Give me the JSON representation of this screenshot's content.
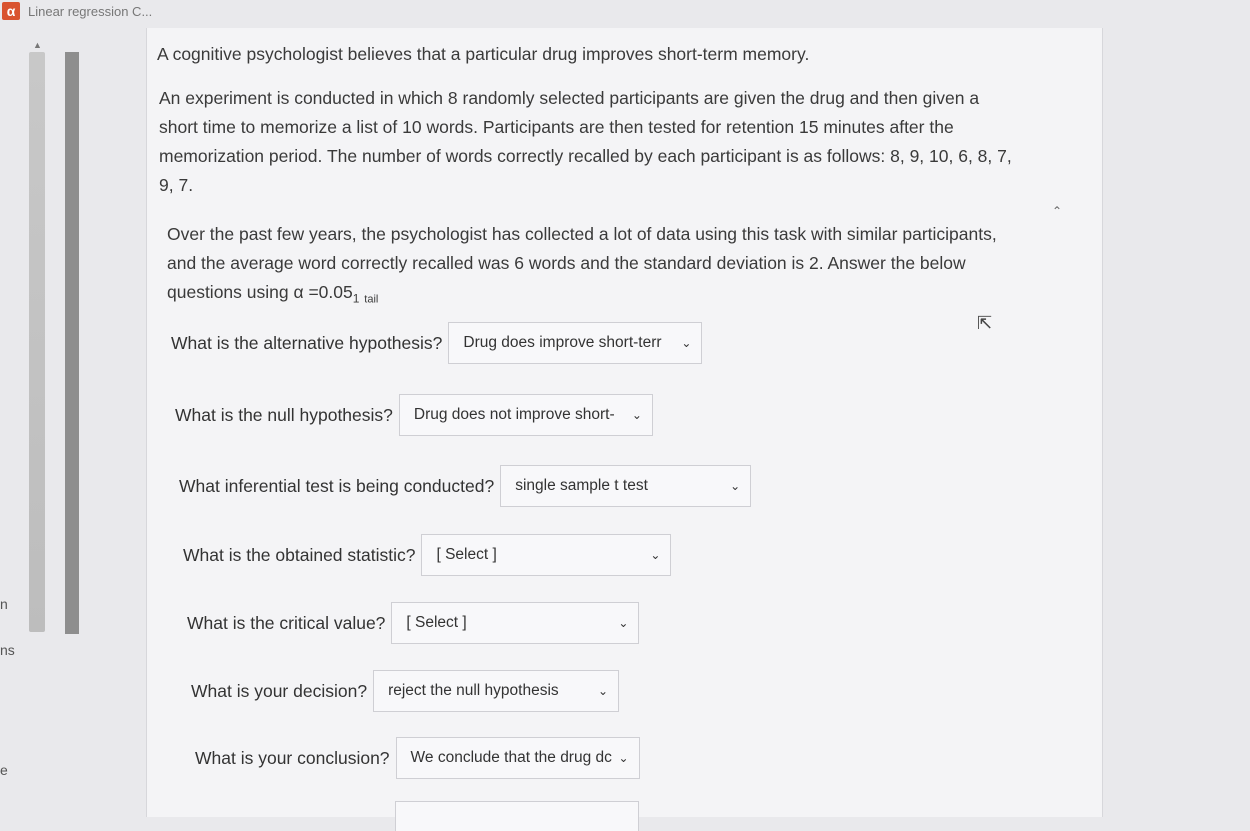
{
  "tab": {
    "icon": "α",
    "title": "Linear regression C..."
  },
  "edge_texts": [
    "n",
    "ns",
    "e"
  ],
  "intro": "A cognitive psychologist believes that a particular drug improves short-term memory.",
  "experiment": [
    "An experiment is conducted in which 8 randomly selected participants are given the drug and then given a",
    "short time to memorize a list of 10 words. Participants are then tested for retention 15 minutes after the",
    "memorization period. The number of words correctly recalled by each participant is as follows: 8, 9, 10, 6, 8, 7,",
    "9, 7."
  ],
  "background": {
    "line1": "Over the past few years, the psychologist has collected a lot of data using this task with similar participants,",
    "line2": "and the average word correctly recalled was 6 words and the standard deviation is 2. Answer the below",
    "line3_prefix": "questions using α =0.05",
    "line3_sub": "1",
    "line3_suffix": "tail"
  },
  "questions": [
    {
      "label": "What is the alternative hypothesis?",
      "value": "Drug does improve short-terr"
    },
    {
      "label": "What is the null hypothesis?",
      "value": "Drug does not improve short-"
    },
    {
      "label": "What inferential test is being conducted?",
      "value": "single sample t test"
    },
    {
      "label": "What is the obtained statistic?",
      "value": "[ Select ]"
    },
    {
      "label": "What is the critical value?",
      "value": "[ Select ]"
    },
    {
      "label": "What is your decision?",
      "value": "reject the null hypothesis"
    },
    {
      "label": "What is your conclusion?",
      "value": "We conclude that the drug dc"
    }
  ],
  "icons": {
    "chevron": "chevron-down-icon",
    "scroll_up": "caret-up-icon",
    "cursor": "mouse-pointer-icon"
  }
}
